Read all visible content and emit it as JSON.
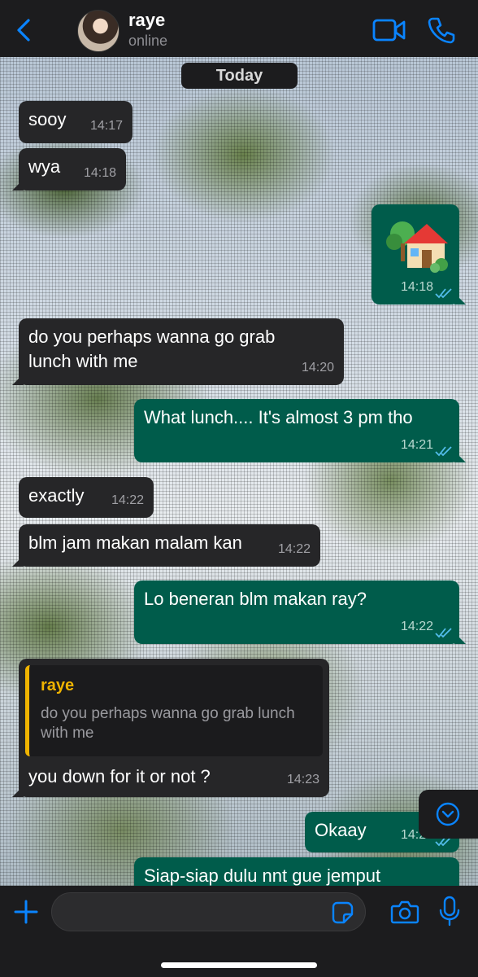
{
  "header": {
    "contact_name": "raye",
    "status": "online"
  },
  "date_label": "Today",
  "messages": [
    {
      "dir": "in",
      "text": "sooy",
      "time": "14:17"
    },
    {
      "dir": "in",
      "text": "wya",
      "time": "14:18"
    },
    {
      "dir": "out",
      "type": "emoji",
      "text": "🏡",
      "time": "14:18",
      "read": true
    },
    {
      "dir": "in",
      "text": "do you perhaps wanna go grab lunch with me",
      "time": "14:20"
    },
    {
      "dir": "out",
      "text": "What lunch.... It's almost 3 pm tho",
      "time": "14:21",
      "read": true
    },
    {
      "dir": "in",
      "text": "exactly",
      "time": "14:22"
    },
    {
      "dir": "in",
      "text": "blm jam makan malam kan",
      "time": "14:22"
    },
    {
      "dir": "out",
      "text": "Lo beneran blm makan ray?",
      "time": "14:22",
      "read": true
    },
    {
      "dir": "in",
      "text": "you down for it or not ?",
      "time": "14:23",
      "reply_to": {
        "author": "raye",
        "text": "do you perhaps wanna go grab lunch with me"
      }
    },
    {
      "dir": "out",
      "text": "Okaay",
      "time": "14:23",
      "read": true
    },
    {
      "dir": "out",
      "text": "Siap-siap dulu nnt gue jemput",
      "time": ""
    }
  ],
  "input": {
    "placeholder": "",
    "value": ""
  },
  "colors": {
    "accent": "#0a84ff",
    "outgoing_bubble": "#005c4b",
    "incoming_bubble": "#262628",
    "quote_accent": "#f0b400",
    "read_ticks": "#53bdeb"
  },
  "icons": [
    "back-chevron",
    "video-camera",
    "phone",
    "chevron-down-circle",
    "plus",
    "sticker",
    "camera",
    "microphone"
  ]
}
